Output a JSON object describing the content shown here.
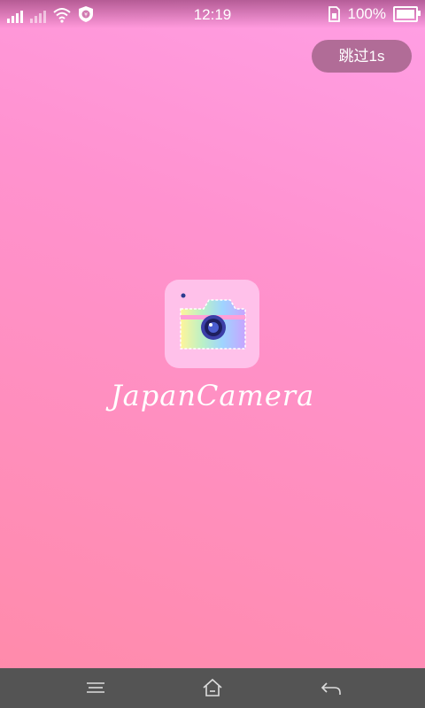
{
  "status_bar": {
    "time": "12:19",
    "battery_percent": "100%",
    "icons": [
      "signal-icon",
      "signal-alt-icon",
      "wifi-icon",
      "security-shield-icon",
      "sim-icon",
      "battery-icon"
    ]
  },
  "skip": {
    "label": "跳过1s"
  },
  "app": {
    "name": "JapanCamera",
    "logo_icon": "camera-app-icon"
  },
  "nav_bar": {
    "icons": [
      "menu-icon",
      "home-icon",
      "back-icon"
    ]
  },
  "colors": {
    "background_top": "#ff9fe5",
    "background_bottom": "#ff8aa8",
    "skip_button": "#b16c97",
    "logo_tile": "#ffc1ea",
    "nav_bar": "#545454"
  }
}
